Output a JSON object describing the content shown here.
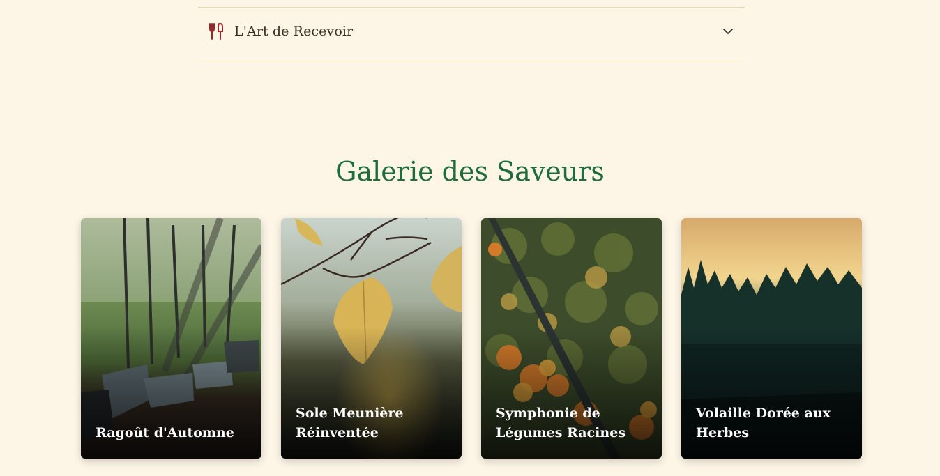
{
  "accordion": {
    "icon": "utensils-icon",
    "title": "L'Art de Recevoir",
    "chevron": "chevron-down-icon",
    "expanded": false
  },
  "gallery": {
    "title": "Galerie des Saveurs",
    "cards": [
      {
        "caption": "Ragoût d'Automne"
      },
      {
        "caption": "Sole Meunière Réinventée"
      },
      {
        "caption": "Symphonie de Légumes Racines"
      },
      {
        "caption": "Volaille Dorée aux Herbes"
      }
    ]
  },
  "colors": {
    "background": "#fdf5e6",
    "accent_green": "#1e6b3c",
    "icon_red": "#a32424",
    "divider": "#e7d7a4",
    "text_dark": "#3a2e22"
  }
}
